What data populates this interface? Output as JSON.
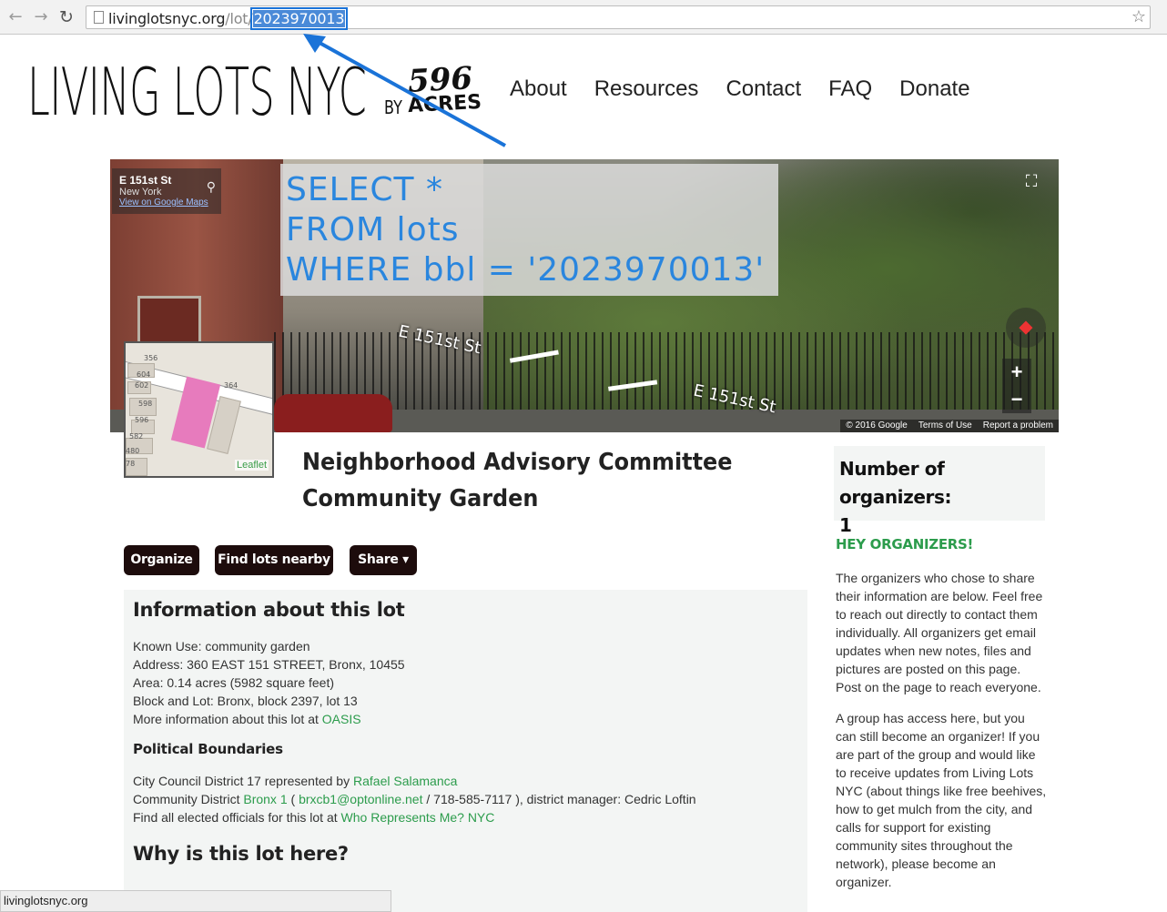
{
  "browser": {
    "url_host": "livinglotsnyc.org",
    "url_path": "/lot/",
    "url_selected": "2023970013",
    "status_text": "livinglotsnyc.org"
  },
  "header": {
    "logo_main": "LIVING LOTS NYC",
    "logo_by": "BY",
    "logo_596": "596",
    "logo_acres": "ACRES",
    "nav": [
      "About",
      "Resources",
      "Contact",
      "FAQ",
      "Donate"
    ]
  },
  "streetview": {
    "street": "E 151st St",
    "city": "New York",
    "gmaps_link": "View on Google Maps",
    "road_label_1": "E 151st St",
    "road_label_2": "E 151st St",
    "copyright": "© 2016 Google",
    "terms": "Terms of Use",
    "report": "Report a problem",
    "zoom_in": "+",
    "zoom_out": "−"
  },
  "annotation": {
    "sql_line1": "SELECT *",
    "sql_line2": "FROM lots",
    "sql_line3": "WHERE bbl = '2023970013'",
    "accent_color": "#1a73d8"
  },
  "minimap": {
    "attribution": "Leaflet",
    "labels": [
      "356",
      "604",
      "602",
      "598",
      "596",
      "582",
      "480",
      "78",
      "364"
    ],
    "lot_color": "#e77bbd"
  },
  "lot": {
    "title_line1": "Neighborhood Advisory Committee",
    "title_line2": "Community Garden"
  },
  "actions": {
    "organize": "Organize",
    "find_nearby": "Find lots nearby",
    "share": "Share ▾"
  },
  "info": {
    "heading": "Information about this lot",
    "known_use": "Known Use: community garden",
    "address": "Address: 360 EAST 151 STREET, Bronx, 10455",
    "area": "Area: 0.14 acres (5982 square feet)",
    "block_lot": "Block and Lot: Bronx, block 2397, lot 13",
    "more_info_prefix": "More information about this lot at ",
    "more_info_link": "OASIS",
    "political_heading": "Political Boundaries",
    "council_prefix": "City Council District 17 represented by ",
    "council_link": "Rafael Salamanca",
    "community_prefix": "Community District ",
    "community_link": "Bronx 1",
    "community_mid1": " ( ",
    "community_email": "brxcb1@optonline.net",
    "community_mid2": " / 718-585-7117 ), district manager: Cedric Loftin",
    "officials_prefix": "Find all elected officials for this lot at ",
    "officials_link": "Who Represents Me? NYC",
    "why_heading": "Why is this lot here?"
  },
  "sidebar": {
    "organizers_label": "Number of organizers:",
    "organizers_count": "1",
    "hey_heading": "HEY ORGANIZERS!",
    "para1": "The organizers who chose to share their information are below. Feel free to reach out directly to contact them individually. All organizers get email updates when new notes, files and pictures are posted on this page. Post on the page to reach everyone.",
    "para2": "A group has access here, but you can still become an organizer! If you are part of the group and would like to receive updates from Living Lots NYC (about things like free beehives, how to get mulch from the city, and calls for support for existing community sites throughout the network), please become an organizer.",
    "accent_color": "#2c9c4c"
  }
}
